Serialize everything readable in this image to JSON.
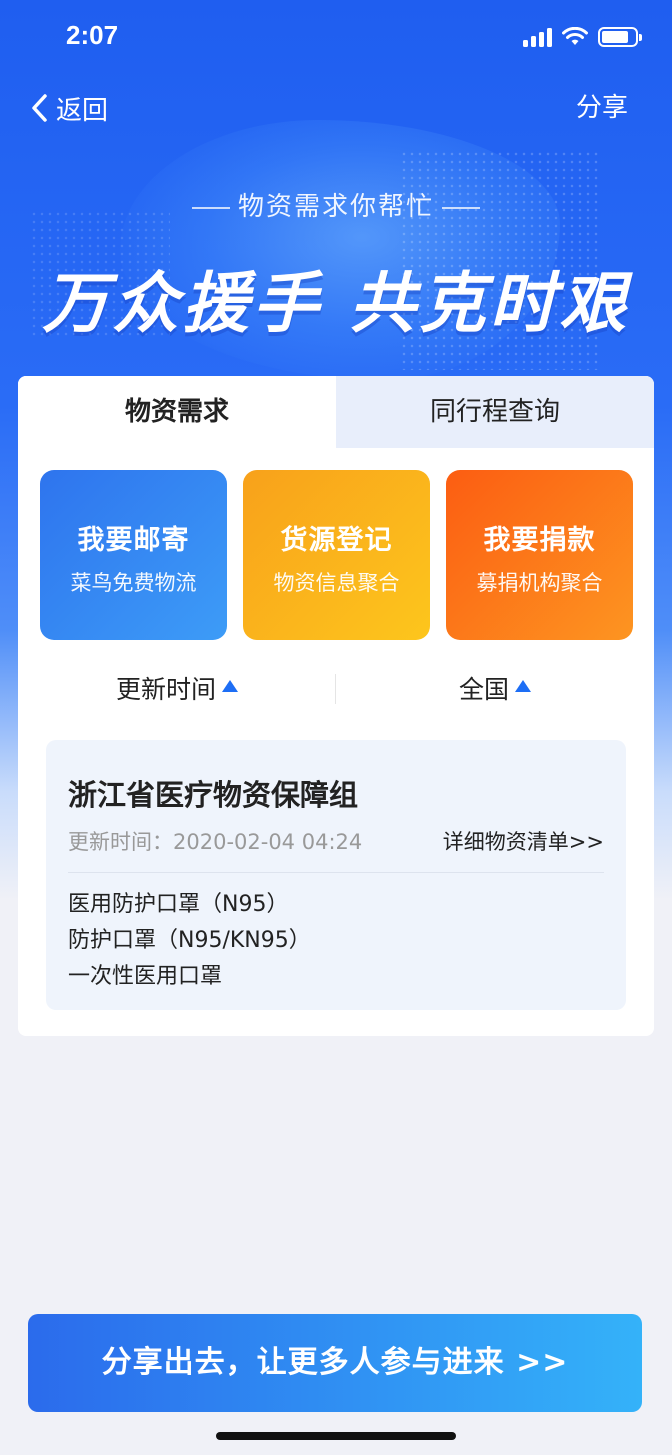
{
  "status_bar": {
    "time": "2:07"
  },
  "nav": {
    "back_label": "返回",
    "share_label": "分享"
  },
  "hero": {
    "subtitle": "物资需求你帮忙",
    "headline": "万众援手 共克时艰"
  },
  "tabs": [
    {
      "label": "物资需求",
      "active": true
    },
    {
      "label": "同行程查询",
      "active": false
    }
  ],
  "actions": [
    {
      "title": "我要邮寄",
      "subtitle": "菜鸟免费物流",
      "color": "#2e74ee"
    },
    {
      "title": "货源登记",
      "subtitle": "物资信息聚合",
      "color": "#fbb21c"
    },
    {
      "title": "我要捐款",
      "subtitle": "募捐机构聚合",
      "color": "#fc6a14"
    }
  ],
  "filters": [
    {
      "label": "更新时间"
    },
    {
      "label": "全国"
    }
  ],
  "item": {
    "org": "浙江省医疗物资保障组",
    "update_time": "更新时间：2020-02-04 04:24",
    "detail_link": "详细物资清单>>",
    "needs": [
      "医用防护口罩（N95）",
      "防护口罩（N95/KN95）",
      "一次性医用口罩"
    ]
  },
  "share_button": {
    "label": "分享出去，让更多人参与进来 >>"
  },
  "colors": {
    "brand_blue": "#1f5ef0",
    "accent_triangle": "#1d6ef5"
  }
}
